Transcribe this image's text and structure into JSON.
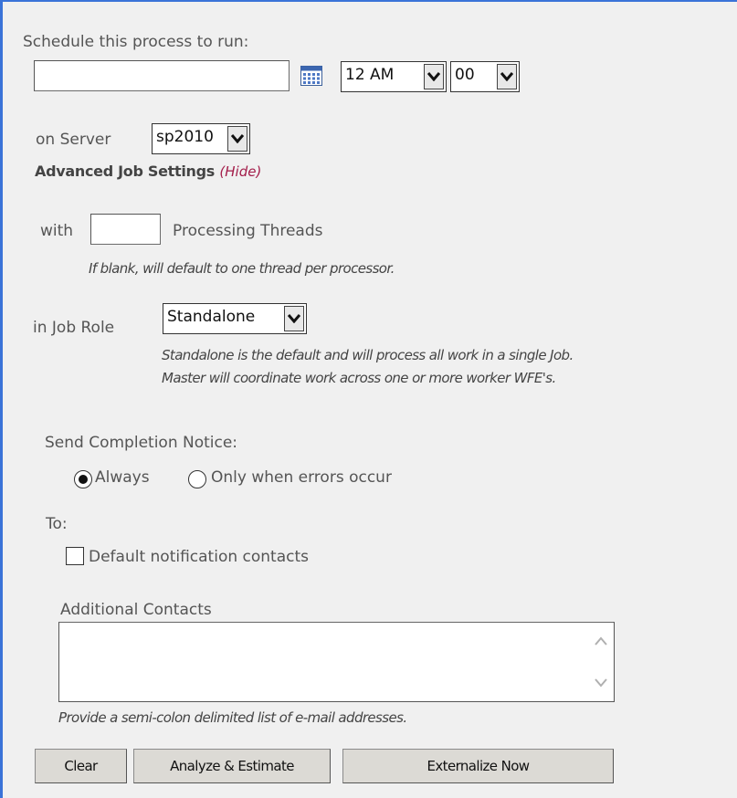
{
  "schedule": {
    "label": "Schedule this process to run:",
    "date_value": "",
    "hour_value": "12 AM",
    "minute_value": "00"
  },
  "server": {
    "label": "on Server",
    "value": "sp2010"
  },
  "advanced": {
    "title": "Advanced Job Settings",
    "hide_link": "(Hide)"
  },
  "threads": {
    "prefix": "with",
    "value": "",
    "suffix": "Processing Threads",
    "hint": "If blank, will default to one thread per processor."
  },
  "job_role": {
    "label": "in Job Role",
    "value": "Standalone",
    "hint_line1": "Standalone is the default and will process all work in a single Job.",
    "hint_line2": "Master will coordinate work across one or more worker WFE's."
  },
  "notice": {
    "label": "Send Completion Notice:",
    "options": [
      "Always",
      "Only when errors occur"
    ],
    "selected": "Always"
  },
  "to": {
    "label": "To:",
    "default_contacts_label": "Default notification contacts",
    "default_contacts_checked": false
  },
  "additional": {
    "label": "Additional Contacts",
    "value": "",
    "hint": "Provide a semi-colon delimited list of e-mail addresses."
  },
  "buttons": {
    "clear": "Clear",
    "analyze": "Analyze & Estimate",
    "externalize": "Externalize Now"
  },
  "colors": {
    "border_accent": "#3a73d8",
    "link": "#a31d4a",
    "background": "#f0f0f0"
  }
}
